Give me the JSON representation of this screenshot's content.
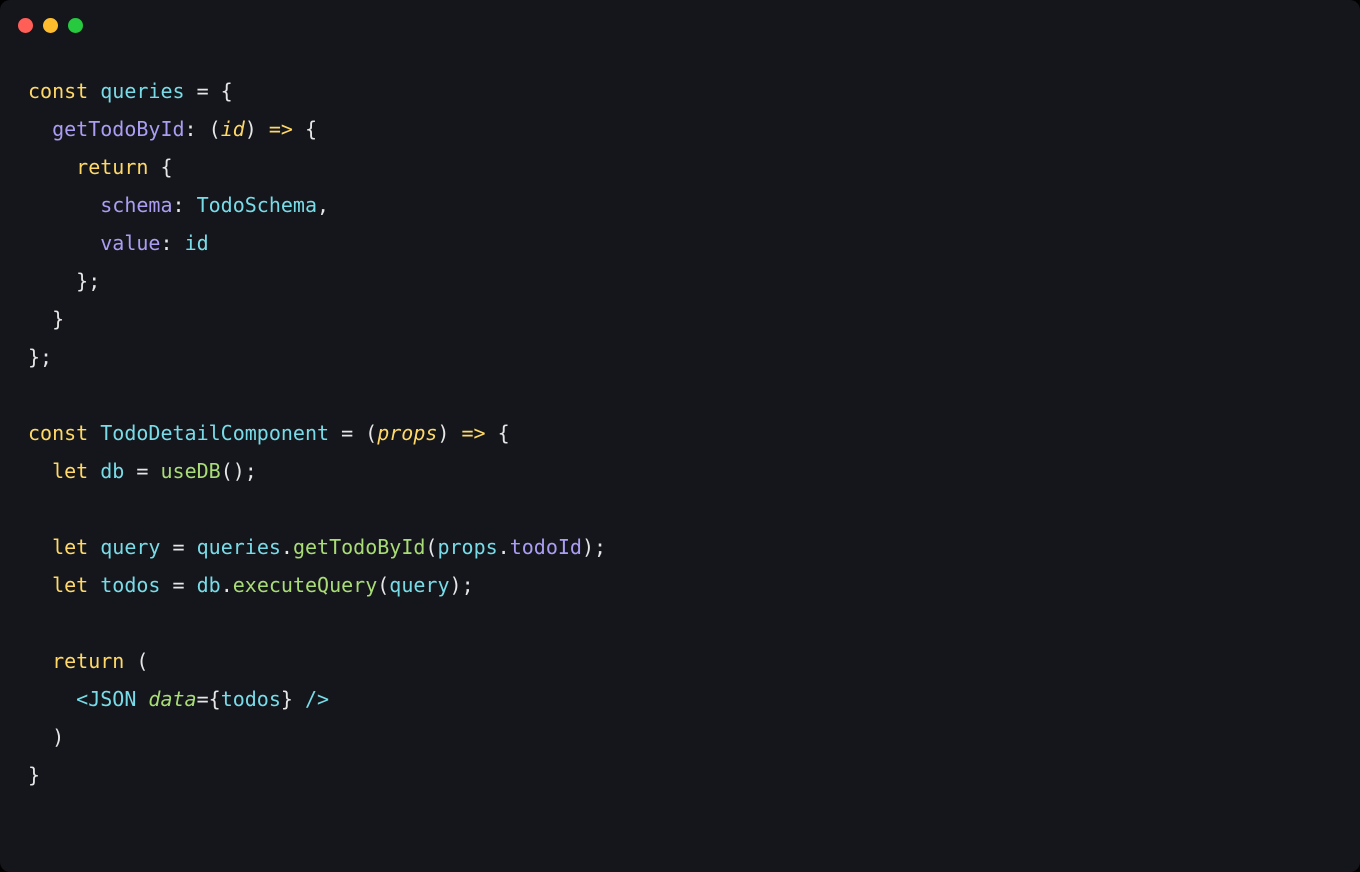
{
  "tokens": {
    "const": "const ",
    "let": "let ",
    "return": "return",
    "arrow": " => ",
    "queries": "queries",
    "TodoDetailComponent": "TodoDetailComponent",
    "getTodoById_key": "getTodoById",
    "getTodoById_call": "getTodoById",
    "id": "id",
    "schema_key": "schema",
    "TodoSchema": "TodoSchema",
    "value_key": "value",
    "props": "props",
    "db": "db",
    "useDB": "useDB",
    "query": "query",
    "todoId": "todoId",
    "todos": "todos",
    "executeQuery": "executeQuery",
    "JSON_tag_open": "<JSON ",
    "data_attr": "data",
    "JSON_tag_close": " />",
    "eq": " = ",
    "colon_sp": ": ",
    "open_brace": "{",
    "close_brace": "}",
    "open_paren": "(",
    "close_paren": ")",
    "semi": ";",
    "comma": ",",
    "dot": ".",
    "indent1": "  ",
    "indent2": "    ",
    "indent3": "      ",
    "blank": ""
  }
}
